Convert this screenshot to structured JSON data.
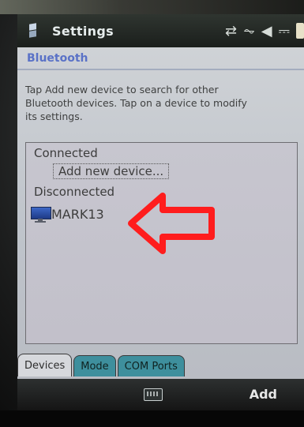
{
  "window": {
    "title": "Settings"
  },
  "status_icons": [
    "connectivity-icon",
    "no-signal-icon",
    "volume-icon",
    "battery-icon"
  ],
  "page": {
    "section_title": "Bluetooth",
    "instructions": "Tap Add new device to search for other\nBluetooth devices. Tap on a device to modify\nits settings."
  },
  "devices_list": {
    "connected_label": "Connected",
    "add_new_label": "Add new device...",
    "disconnected_label": "Disconnected",
    "devices": [
      {
        "name": "MARK13",
        "icon": "computer-icon"
      }
    ]
  },
  "tabs": [
    {
      "label": "Devices",
      "active": true
    },
    {
      "label": "Mode",
      "active": false
    },
    {
      "label": "COM Ports",
      "active": false
    }
  ],
  "softkeys": {
    "left_icon": "keyboard-icon",
    "right_label": "Add"
  },
  "colors": {
    "accent": "#5a72c7",
    "arrow_red": "#ff1d1d",
    "tab_inactive": "#3e8f9d"
  }
}
